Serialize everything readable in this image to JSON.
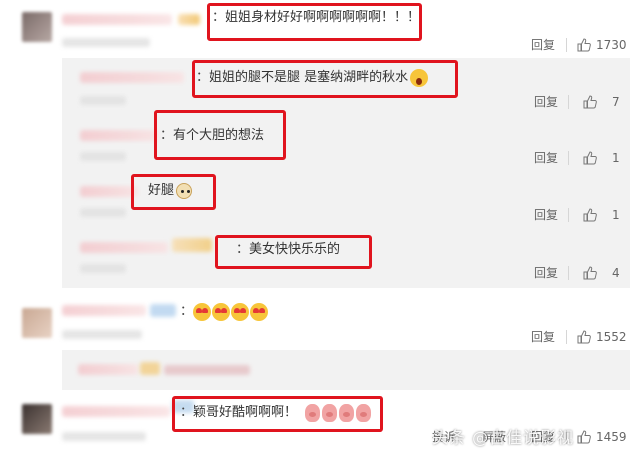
{
  "comments": [
    {
      "text": "姐姐身材好好啊啊啊啊啊啊！！！",
      "reply_label": "回复",
      "likes": "1730"
    },
    {
      "text": "姐姐的腿不是腿 是塞纳湖畔的秋水",
      "reply_label": "回复",
      "likes": "7"
    },
    {
      "text": "有个大胆的想法",
      "reply_label": "回复",
      "likes": "1"
    },
    {
      "text": "好腿",
      "reply_label": "回复",
      "likes": "1"
    },
    {
      "text": "美女快快乐乐的",
      "reply_label": "回复",
      "likes": "4"
    },
    {
      "text": "",
      "reply_label": "回复",
      "likes": "1552"
    },
    {
      "text": "颖哥好酷啊啊啊！",
      "reply_label": "回复",
      "likes": "1459"
    }
  ],
  "last_row_actions": [
    "投诉",
    "屏蔽"
  ],
  "colon": "：",
  "watermark": "头条 @古佳说影视",
  "colors": {
    "highlight_border": "#e0141e",
    "reply_bg": "#f2f2f2"
  }
}
